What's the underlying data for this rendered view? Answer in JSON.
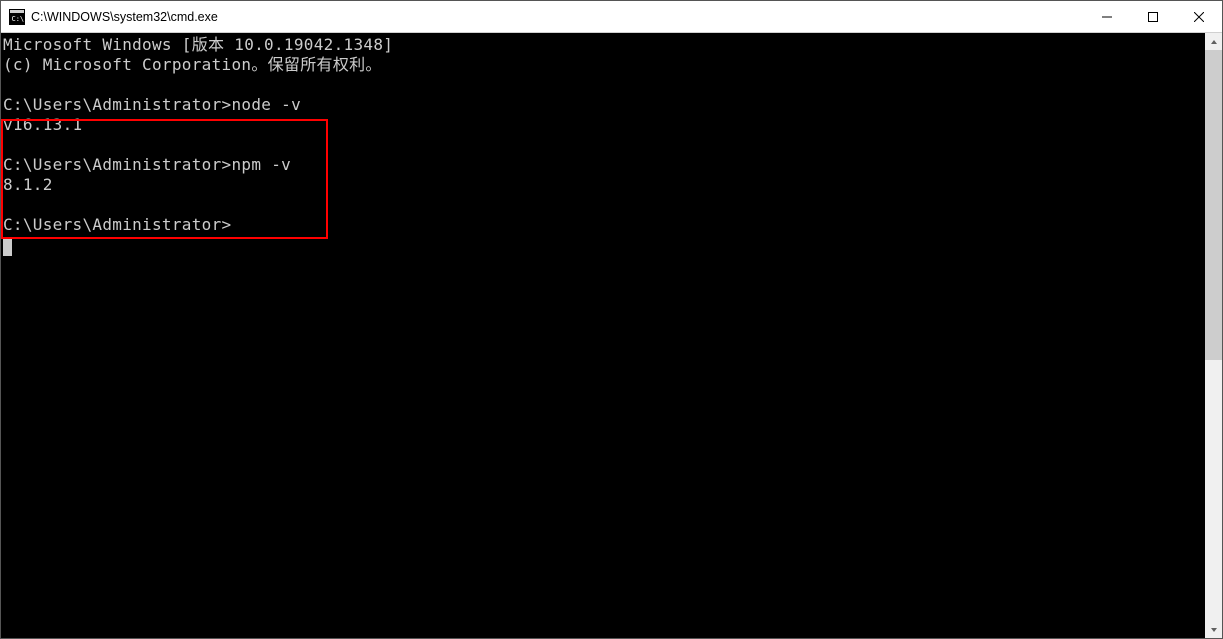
{
  "window": {
    "title": "C:\\WINDOWS\\system32\\cmd.exe"
  },
  "console": {
    "banner_line1": "Microsoft Windows [版本 10.0.19042.1348]",
    "banner_line2": "(c) Microsoft Corporation。保留所有权利。",
    "prompt1": "C:\\Users\\Administrator>",
    "cmd1": "node -v",
    "out1": "v16.13.1",
    "prompt2": "C:\\Users\\Administrator>",
    "cmd2": "npm -v",
    "out2": "8.1.2",
    "prompt3": "C:\\Users\\Administrator>"
  },
  "colors": {
    "console_bg": "#000000",
    "console_fg": "#cccccc",
    "highlight": "#ff0000"
  }
}
